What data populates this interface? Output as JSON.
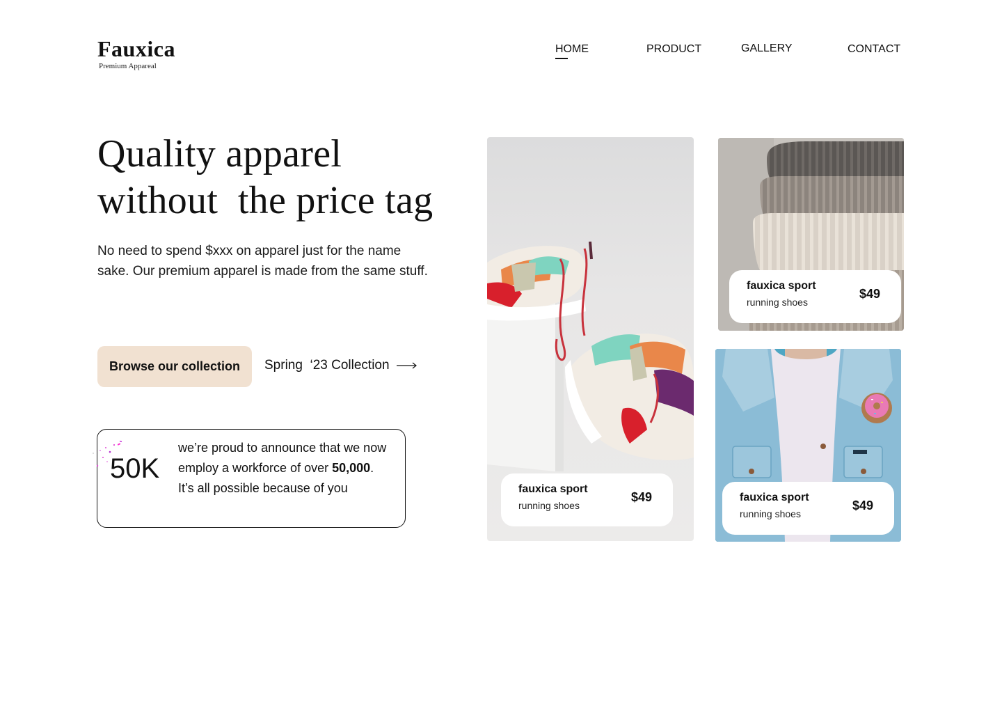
{
  "brand": {
    "name": "Fauxica",
    "tagline": "Premium Appareal"
  },
  "nav": {
    "items": [
      {
        "label": "HOME",
        "active": true
      },
      {
        "label": "PRODUCT",
        "active": false
      },
      {
        "label": "GALLERY",
        "active": false
      },
      {
        "label": "CONTACT",
        "active": false
      }
    ]
  },
  "hero": {
    "title_line1": "Quality apparel",
    "title_line2": "without  the price tag",
    "subtitle": "No need to spend $xxx on apparel just for the name sake. Our premium apparel is made from the same stuff."
  },
  "cta": {
    "primary_label": "Browse our collection",
    "secondary_label": "Spring  ‘23 Collection",
    "secondary_icon": "long-arrow-right-icon",
    "primary_bg": "#f1e1d1"
  },
  "stat": {
    "number": "50K",
    "text_before": "we’re proud  to announce that we now employ a workforce of over ",
    "highlight": "50,000",
    "text_after": ". It’s all possible because of you",
    "icon": "confetti-icon"
  },
  "products": [
    {
      "name": "fauxica sport",
      "type": "running shoes",
      "price": "$49",
      "image": "sneakers-photo"
    },
    {
      "name": "fauxica sport",
      "type": "running shoes",
      "price": "$49",
      "image": "knit-sweaters-photo"
    },
    {
      "name": "fauxica sport",
      "type": "running shoes",
      "price": "$49",
      "image": "denim-jacket-photo"
    }
  ]
}
